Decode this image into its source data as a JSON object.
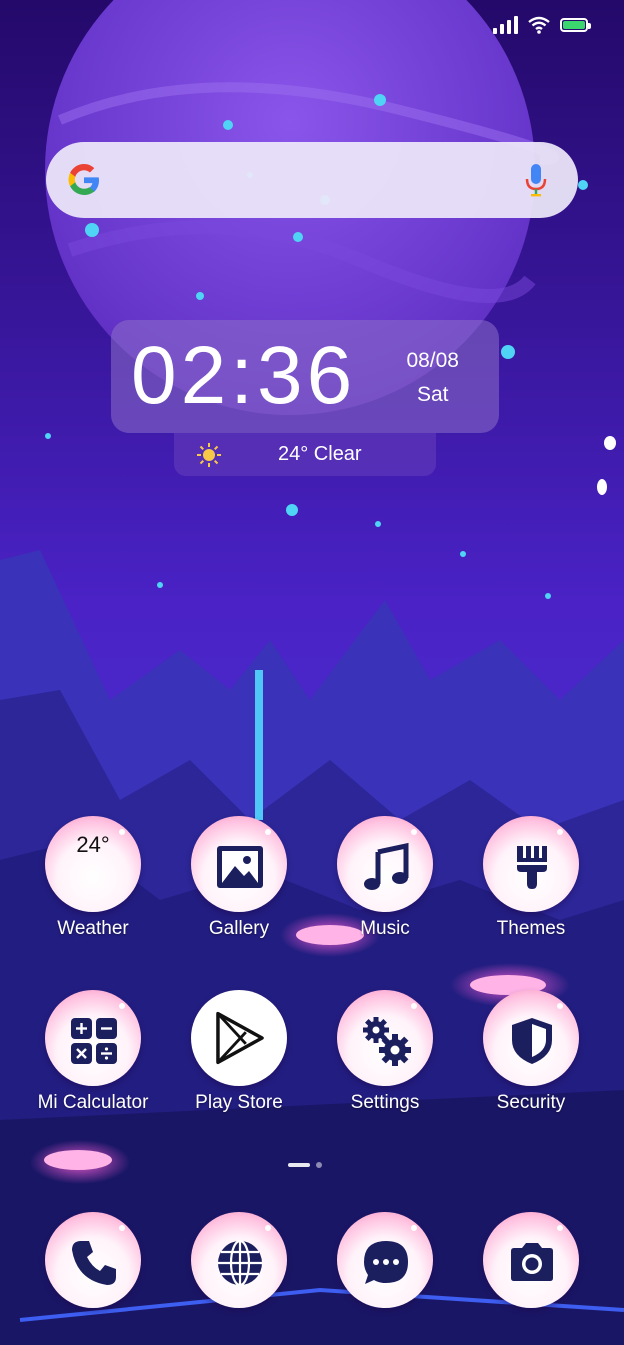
{
  "status_bar": {
    "signal_icon": "signal-icon",
    "wifi_icon": "wifi-icon",
    "battery_icon": "battery-icon",
    "battery_color": "#3cd66e"
  },
  "search_widget": {
    "logo_icon": "google-logo-icon",
    "mic_icon": "mic-icon"
  },
  "clock_widget": {
    "time": "02:36",
    "date": "08/08",
    "day": "Sat"
  },
  "weather_widget": {
    "icon": "sun-icon",
    "text": "24° Clear"
  },
  "apps": [
    {
      "label": "Weather",
      "icon": "weather-icon",
      "icon_text": "24°"
    },
    {
      "label": "Gallery",
      "icon": "gallery-icon"
    },
    {
      "label": "Music",
      "icon": "music-icon"
    },
    {
      "label": "Themes",
      "icon": "themes-brush-icon"
    },
    {
      "label": "Mi Calculator",
      "icon": "calculator-icon"
    },
    {
      "label": "Play Store",
      "icon": "play-store-icon"
    },
    {
      "label": "Settings",
      "icon": "settings-gear-icon"
    },
    {
      "label": "Security",
      "icon": "security-shield-icon"
    }
  ],
  "dock": [
    {
      "icon": "phone-icon"
    },
    {
      "icon": "browser-globe-icon"
    },
    {
      "icon": "messaging-icon"
    },
    {
      "icon": "camera-icon"
    }
  ],
  "pager": {
    "pages": 2,
    "current": 1
  },
  "colors": {
    "icon_glyph": "#1b1f5e",
    "bubble_pink": "#f47cb7",
    "sky_top": "#2b0f6e",
    "sky_bottom": "#5a3fd0"
  }
}
